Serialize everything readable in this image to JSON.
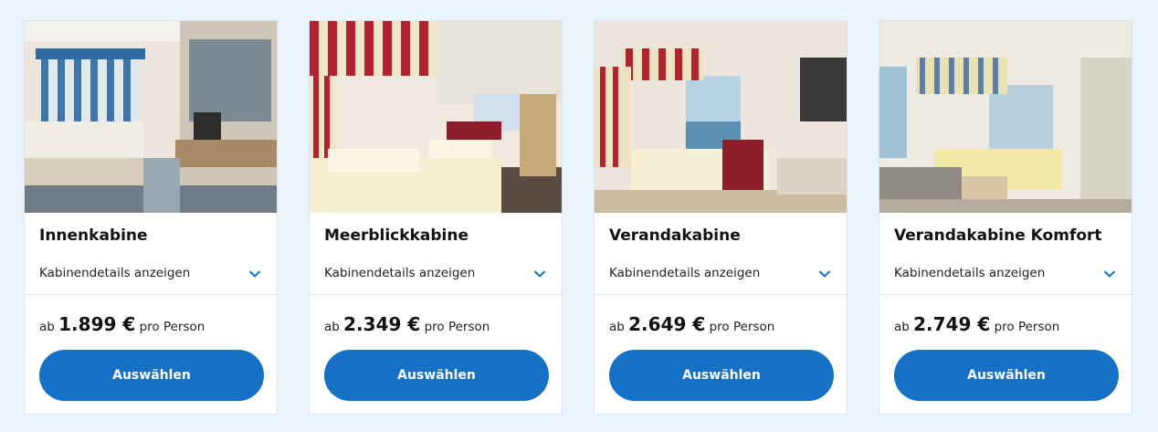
{
  "cards": [
    {
      "title": "Innenkabine",
      "details_label": "Kabinendetails anzeigen",
      "price_prefix": "ab",
      "price": "1.899 €",
      "price_suffix": "pro Person",
      "button_label": "Auswählen",
      "photo": "inside-cabin-photo"
    },
    {
      "title": "Meerblickkabine",
      "details_label": "Kabinendetails anzeigen",
      "price_prefix": "ab",
      "price": "2.349 €",
      "price_suffix": "pro Person",
      "button_label": "Auswählen",
      "photo": "ocean-view-cabin-photo"
    },
    {
      "title": "Verandakabine",
      "details_label": "Kabinendetails anzeigen",
      "price_prefix": "ab",
      "price": "2.649 €",
      "price_suffix": "pro Person",
      "button_label": "Auswählen",
      "photo": "veranda-cabin-photo"
    },
    {
      "title": "Verandakabine Komfort",
      "details_label": "Kabinendetails anzeigen",
      "price_prefix": "ab",
      "price": "2.749 €",
      "price_suffix": "pro Person",
      "button_label": "Auswählen",
      "photo": "veranda-comfort-cabin-photo"
    }
  ],
  "colors": {
    "page_background": "#eaf4fd",
    "button": "#1670c4",
    "chevron": "#1670c4"
  },
  "icons": {
    "expand": "chevron-down-icon"
  }
}
